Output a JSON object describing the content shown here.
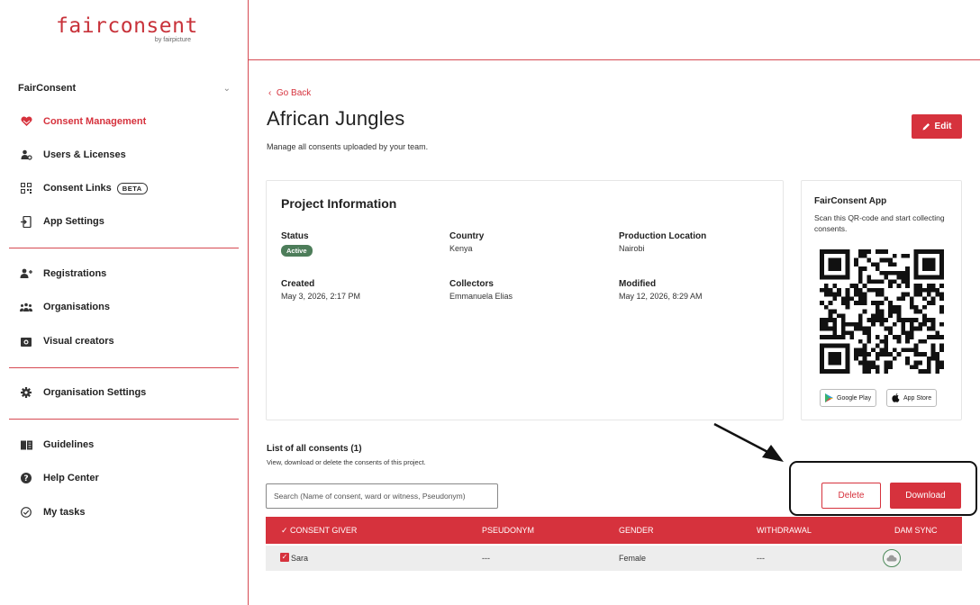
{
  "brand": {
    "name": "fairconsent",
    "sub": "by fairpicture",
    "accent": "#d6323d"
  },
  "sidebar": {
    "group_title": "FairConsent",
    "items": [
      {
        "label": "Consent Management",
        "icon": "heart-icon",
        "active": true
      },
      {
        "label": "Users & Licenses",
        "icon": "users-gear-icon"
      },
      {
        "label": "Consent Links",
        "icon": "qr-code-icon",
        "badge": "BETA"
      },
      {
        "label": "App Settings",
        "icon": "app-settings-icon"
      },
      {
        "label": "Registrations",
        "icon": "user-plus-icon"
      },
      {
        "label": "Organisations",
        "icon": "group-icon"
      },
      {
        "label": "Visual creators",
        "icon": "camera-icon"
      },
      {
        "label": "Organisation Settings",
        "icon": "gear-icon"
      },
      {
        "label": "Guidelines",
        "icon": "book-icon"
      },
      {
        "label": "Help Center",
        "icon": "help-icon"
      },
      {
        "label": "My tasks",
        "icon": "check-circle-icon"
      }
    ]
  },
  "main": {
    "go_back": "Go Back",
    "title": "African Jungles",
    "description": "Manage all consents uploaded by your team.",
    "edit_label": "Edit"
  },
  "project_info": {
    "title": "Project Information",
    "status_label": "Status",
    "status_value": "Active",
    "country_label": "Country",
    "country_value": "Kenya",
    "location_label": "Production Location",
    "location_value": "Nairobi",
    "created_label": "Created",
    "created_value": "May 3, 2026, 2:17 PM",
    "collectors_label": "Collectors",
    "collectors_value": "Emmanuela Elias",
    "modified_label": "Modified",
    "modified_value": "May 12, 2026, 8:29 AM"
  },
  "app_card": {
    "title": "FairConsent App",
    "description": "Scan this QR-code and start collecting consents.",
    "google_play": "Google Play",
    "app_store": "App Store"
  },
  "consents": {
    "title": "List of all consents (1)",
    "description": "View, download or delete the consents of this project.",
    "search_placeholder": "Search (Name of consent, ward or witness, Pseudonym)",
    "delete_label": "Delete",
    "download_label": "Download",
    "columns": [
      "CONSENT GIVER",
      "PSEUDONYM",
      "GENDER",
      "WITHDRAWAL",
      "DAM SYNC"
    ],
    "rows": [
      {
        "consent_giver": "Sara",
        "pseudonym": "---",
        "gender": "Female",
        "withdrawal": "---"
      }
    ]
  }
}
